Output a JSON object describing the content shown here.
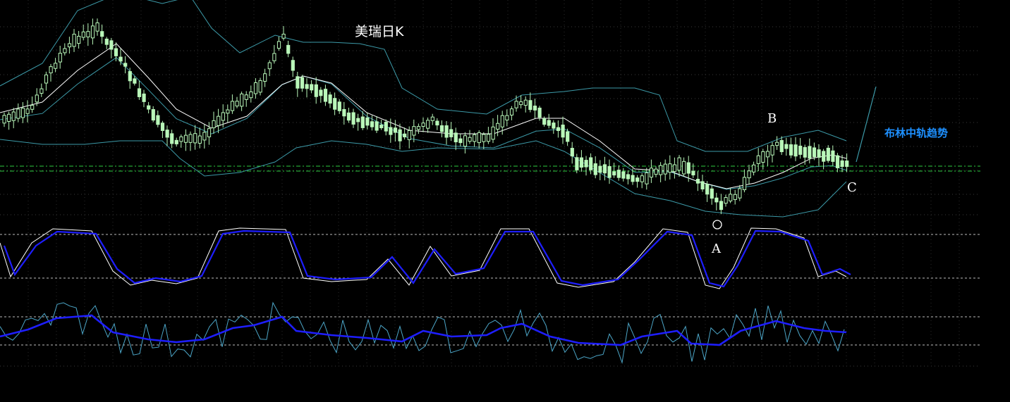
{
  "chart_data": [
    {
      "type": "candlestick",
      "title": "美瑞日K",
      "indicators": [
        "Bollinger upper",
        "Bollinger middle",
        "Bollinger lower",
        "moving average"
      ],
      "annotations": {
        "point_a": "A",
        "point_b": "B",
        "point_c": "C",
        "trend_note": "布林中轨趋势"
      },
      "colors": {
        "candle": "#b9f7b9",
        "bollinger": "#3c9aa8",
        "ma": "#ffffff",
        "level_lines": "#2ecc40",
        "grid": "#3a3a3a",
        "trend_note": "#1e90ff"
      }
    },
    {
      "type": "line",
      "series": [
        {
          "color": "#1e1eff"
        },
        {
          "color": "#ffffff"
        }
      ],
      "levels": 2
    },
    {
      "type": "line",
      "series": [
        {
          "color": "#1e1eff"
        },
        {
          "color": "#4ca6c8"
        }
      ],
      "levels": 2
    }
  ]
}
